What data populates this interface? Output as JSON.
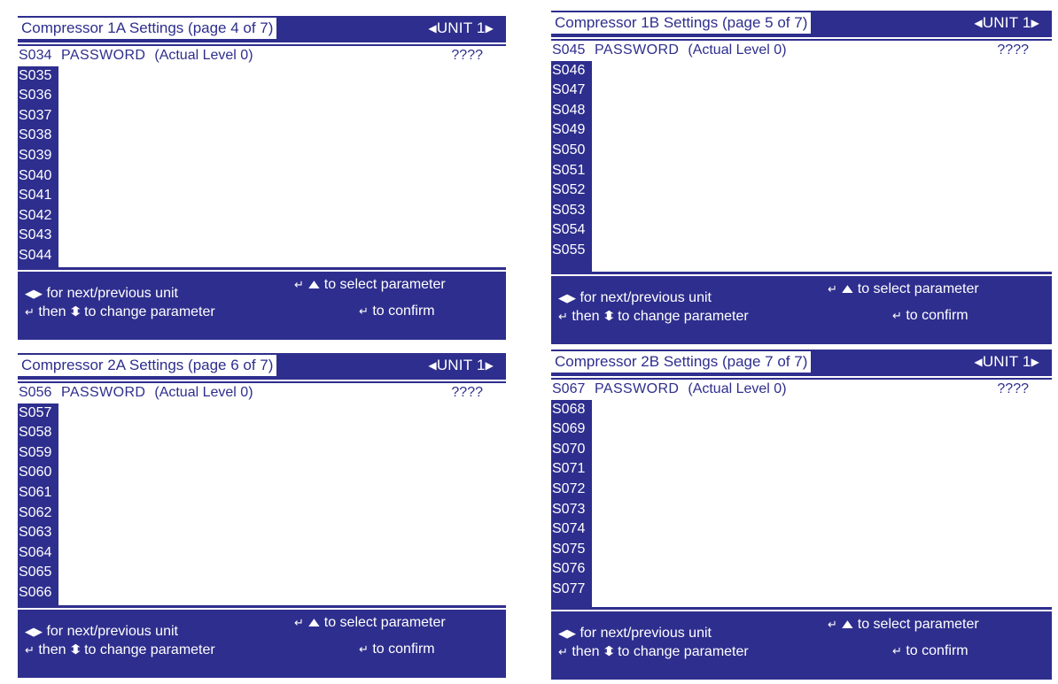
{
  "panels": [
    {
      "title": "Compressor 1A Settings (page  4 of 7)",
      "unit": "UNIT 1",
      "codes": [
        "S034",
        "S035",
        "S036",
        "S037",
        "S038",
        "S039",
        "S040",
        "S041",
        "S042",
        "S043",
        "S044"
      ],
      "param_name": "PASSWORD",
      "param_level": "(Actual Level  0)",
      "param_value": "????"
    },
    {
      "title": "Compressor 1B Settings (page  5 of 7)",
      "unit": "UNIT 1",
      "codes": [
        "S045",
        "S046",
        "S047",
        "S048",
        "S049",
        "S050",
        "S051",
        "S052",
        "S053",
        "S054",
        "S055"
      ],
      "param_name": "PASSWORD",
      "param_level": "(Actual Level  0)",
      "param_value": "????"
    },
    {
      "title": "Compressor 2A Settings (page  6 of 7)",
      "unit": "UNIT 1",
      "codes": [
        "S056",
        "S057",
        "S058",
        "S059",
        "S060",
        "S061",
        "S062",
        "S063",
        "S064",
        "S065",
        "S066"
      ],
      "param_name": "PASSWORD",
      "param_level": "(Actual Level  0)",
      "param_value": "????"
    },
    {
      "title": "Compressor 2B Settings (page  7 of 7)",
      "unit": "UNIT 1",
      "codes": [
        "S067",
        "S068",
        "S069",
        "S070",
        "S071",
        "S072",
        "S073",
        "S074",
        "S075",
        "S076",
        "S077"
      ],
      "param_name": "PASSWORD",
      "param_level": "(Actual Level  0)",
      "param_value": "????"
    }
  ],
  "help": {
    "select": "to select parameter",
    "next": "for next/previous unit",
    "then": "then",
    "change": "to change parameter",
    "confirm": "to confirm"
  },
  "icons": {
    "unit_arrows": "left-right-triangle-icon",
    "enter": "enter-key-icon",
    "up_down": "up-down-arrow-icon"
  },
  "colors": {
    "panel_bg": "#2e2e8e",
    "content_bg": "#ffffff"
  }
}
